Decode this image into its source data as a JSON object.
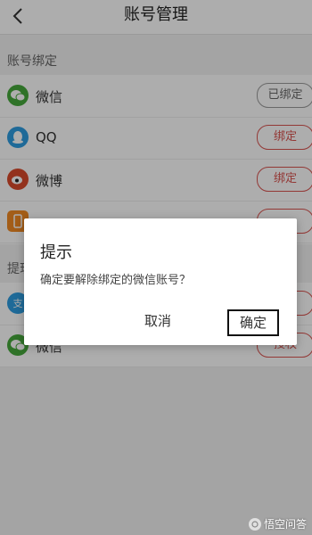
{
  "nav": {
    "title": "账号管理",
    "back_icon": "chevron-left-icon"
  },
  "section1": {
    "title": "账号绑定",
    "rows": [
      {
        "label": "微信",
        "button": "已绑定",
        "icon": "wechat-icon",
        "color": "#46a83b",
        "state": "bound"
      },
      {
        "label": "QQ",
        "button": "绑定",
        "icon": "qq-icon",
        "color": "#2f9de0",
        "state": "unbound"
      },
      {
        "label": "微博",
        "button": "绑定",
        "icon": "weibo-icon",
        "color": "#d94a2b",
        "state": "unbound"
      },
      {
        "label": "",
        "button": "",
        "icon": "phone-icon",
        "color": "#f08a24",
        "state": "unbound"
      }
    ]
  },
  "section2": {
    "title": "提现",
    "rows": [
      {
        "label": "",
        "button": "",
        "icon": "alipay-icon",
        "color": "#2f9de0"
      },
      {
        "label": "微信",
        "button": "授权",
        "icon": "wechat-icon",
        "color": "#46a83b"
      }
    ]
  },
  "dialog": {
    "title": "提示",
    "message": "确定要解除绑定的微信账号？",
    "cancel": "取消",
    "confirm": "确定"
  },
  "watermark": {
    "text": "悟空问答"
  },
  "colors": {
    "accent": "#d9534f",
    "muted": "#9a9a9a"
  }
}
